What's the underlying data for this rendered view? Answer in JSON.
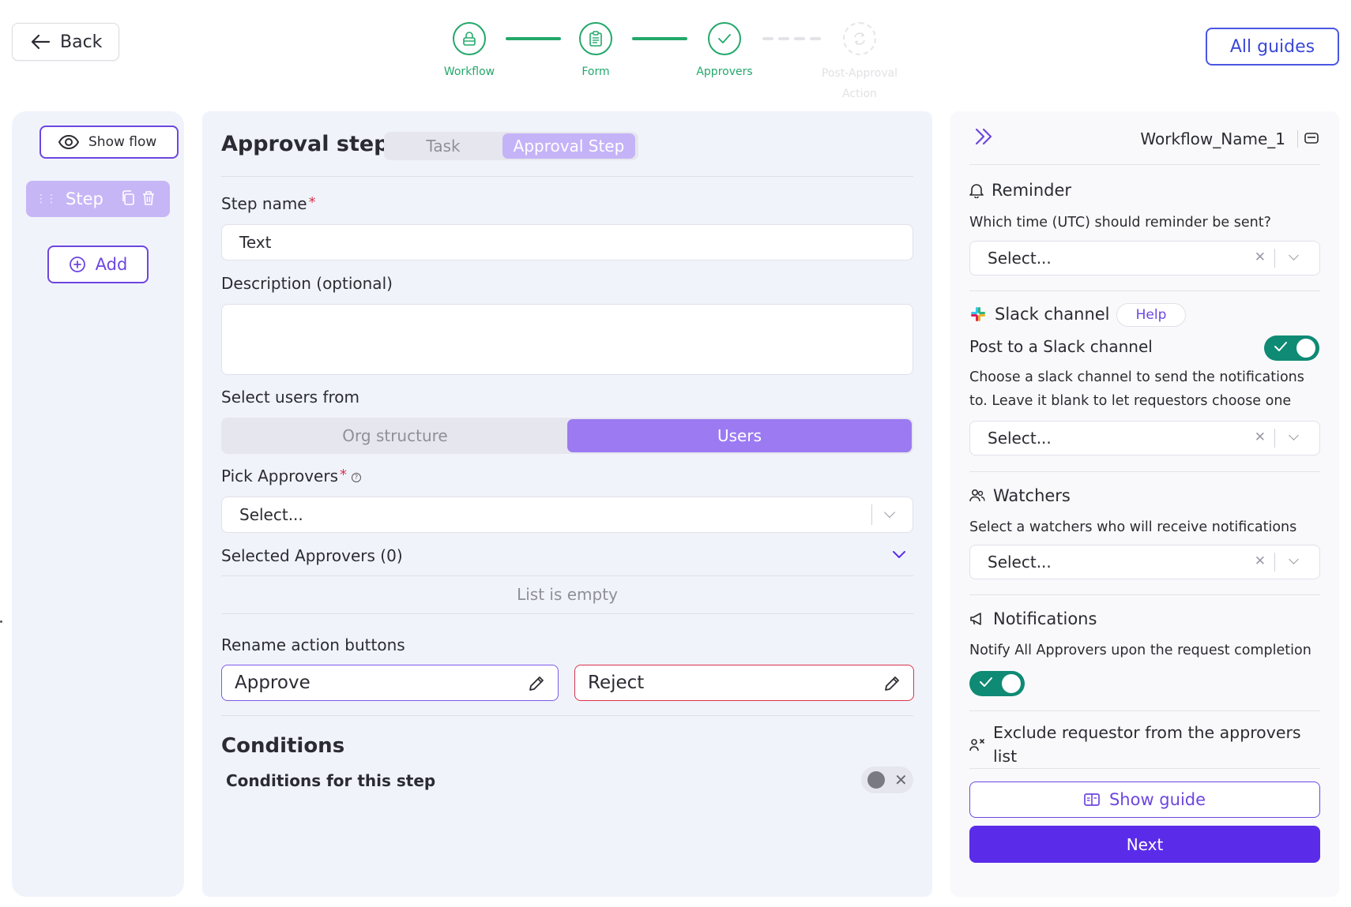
{
  "header": {
    "back_label": "Back",
    "all_guides_label": "All guides",
    "steps": [
      {
        "label": "Workflow",
        "state": "done",
        "icon": "lock-icon"
      },
      {
        "label": "Form",
        "state": "done",
        "icon": "clipboard-icon"
      },
      {
        "label": "Approvers",
        "state": "done",
        "icon": "check-icon"
      },
      {
        "label": "Post-Approval Action",
        "state": "pending",
        "icon": "repeat-icon"
      }
    ],
    "accent_color": "#23a86b"
  },
  "left": {
    "show_flow_label": "Show flow",
    "step_label": "Step",
    "add_label": "Add"
  },
  "main": {
    "title": "Approval step",
    "type_tabs": [
      {
        "label": "Task"
      },
      {
        "label": "Approval Step",
        "selected": true
      }
    ],
    "step_name_label": "Step name",
    "step_name_value": "Text",
    "description_label": "Description  (optional)",
    "description_value": "",
    "select_users_label": "Select users from",
    "select_users_options": [
      {
        "label": "Org structure"
      },
      {
        "label": "Users",
        "selected": true
      }
    ],
    "pick_approvers_label": "Pick Approvers",
    "pick_approvers_placeholder": "Select...",
    "selected_approvers_label": "Selected Approvers (0)",
    "list_empty_text": "List is empty",
    "rename_buttons_label": "Rename action buttons",
    "approve_value": "Approve",
    "reject_value": "Reject",
    "conditions_title": "Conditions",
    "conditions_sub": "Conditions for this step",
    "conditions_enabled": false
  },
  "right": {
    "workflow_name": "Workflow_Name_1",
    "reminder_title": "Reminder",
    "reminder_question": "Which time (UTC) should reminder be sent?",
    "reminder_placeholder": "Select...",
    "slack_title": "Slack channel",
    "help_label": "Help",
    "slack_post_label": "Post to a Slack channel",
    "slack_post_enabled": true,
    "slack_desc": "Choose a slack channel to send the notifications to. Leave it blank to let requestors choose one",
    "slack_placeholder": "Select...",
    "watchers_title": "Watchers",
    "watchers_desc": "Select a watchers who will receive notifications",
    "watchers_placeholder": "Select...",
    "notifications_title": "Notifications",
    "notifications_desc": "Notify All Approvers upon the request completion",
    "notifications_enabled": true,
    "exclude_title": "Exclude requestor from the approvers list",
    "show_guide_label": "Show guide",
    "next_label": "Next"
  },
  "colors": {
    "primary": "#5a2cea",
    "primary_light": "#c5b3f8",
    "success": "#23a86b",
    "toggle_on": "#0f8a74",
    "danger": "#d8344a",
    "panel_bg": "#f1f3fb"
  }
}
